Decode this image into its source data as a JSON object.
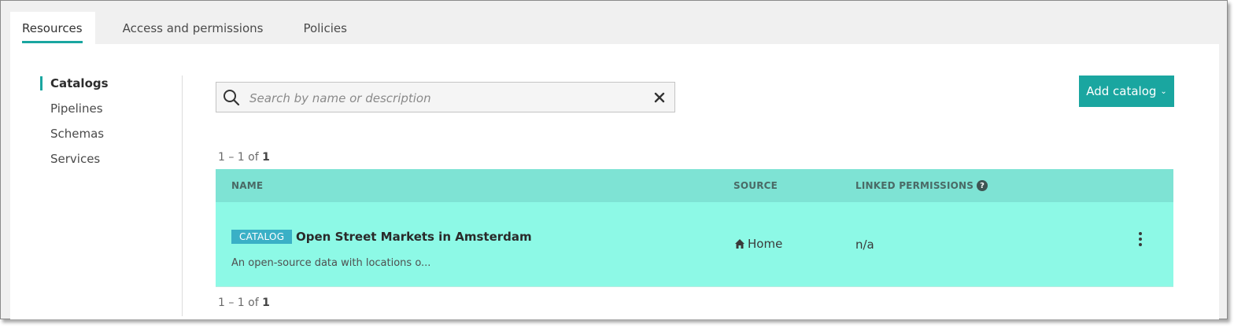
{
  "tabs": [
    "Resources",
    "Access and permissions",
    "Policies"
  ],
  "sidebar": {
    "items": [
      "Catalogs",
      "Pipelines",
      "Schemas",
      "Services"
    ]
  },
  "search": {
    "placeholder": "Search by name or description",
    "value": ""
  },
  "toolbar": {
    "add_label": "Add catalog",
    "add_chevron": "⌄"
  },
  "pagination": {
    "prefix": "1 – 1 of ",
    "total": "1"
  },
  "table": {
    "headers": {
      "name": "NAME",
      "source": "SOURCE",
      "permissions": "LINKED PERMISSIONS",
      "help": "?"
    },
    "rows": [
      {
        "badge": "CATALOG",
        "title": "Open Street Markets in Amsterdam",
        "description": "An open-source data with locations o...",
        "source": "Home",
        "permissions": "n/a"
      }
    ]
  },
  "colors": {
    "accent": "#1aa6a0",
    "header_bg": "#7ee3d4",
    "row_bg": "#8df9e6",
    "badge_bg": "#3ab0c6"
  },
  "icons": {
    "search": "search-icon",
    "clear": "close-icon",
    "home": "home-icon",
    "help": "help-icon",
    "more": "more-vertical-icon"
  }
}
